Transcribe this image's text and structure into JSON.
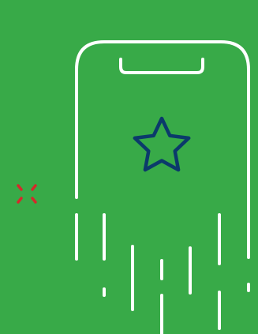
{
  "colors": {
    "background": "#38aa48",
    "phone_outline": "#ffffff",
    "star": "#0b3a6b",
    "sparkle": "#d42a2a"
  },
  "icons": {
    "device": "smartphone-outline-icon",
    "favorite": "star-icon",
    "sparkle": "sparkle-icon",
    "motion": "speed-lines"
  }
}
